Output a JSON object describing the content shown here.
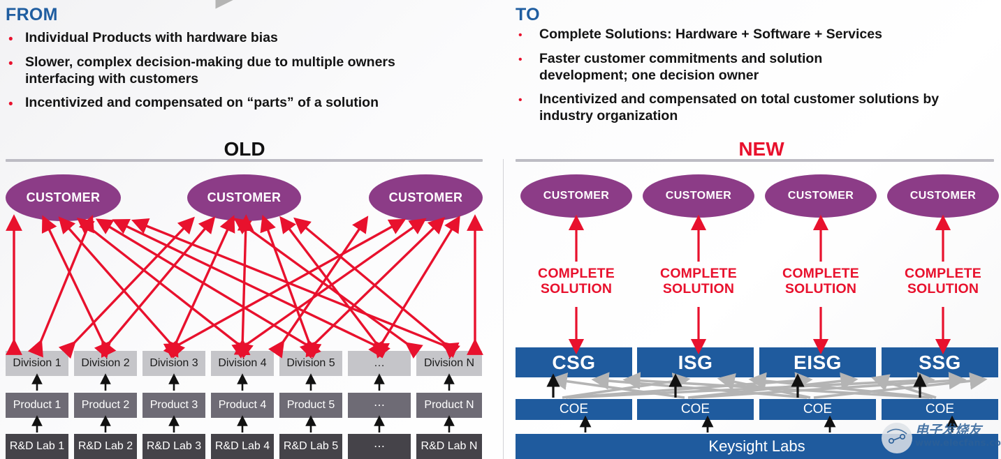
{
  "left": {
    "kicker": "FROM",
    "bullets": [
      "Individual Products with hardware bias",
      "Slower, complex decision-making due to multiple owners interfacing with customers",
      "Incentivized and compensated on “parts” of a solution"
    ],
    "section_title": "OLD",
    "customers": [
      "CUSTOMER",
      "CUSTOMER",
      "CUSTOMER"
    ],
    "divisions": [
      "Division 1",
      "Division 2",
      "Division 3",
      "Division 4",
      "Division 5",
      "…",
      "Division N"
    ],
    "products": [
      "Product 1",
      "Product 2",
      "Product 3",
      "Product 4",
      "Product 5",
      "⋯",
      "Product N"
    ],
    "rd_labs": [
      "R&D Lab 1",
      "R&D Lab 2",
      "R&D Lab 3",
      "R&D Lab 4",
      "R&D Lab 5",
      "⋯",
      "R&D Lab N"
    ]
  },
  "right": {
    "kicker": "TO",
    "bullets": [
      "Complete Solutions: Hardware + Software + Services",
      "Faster customer commitments and solution development; one decision owner",
      "Incentivized and compensated on total customer solutions by industry organization"
    ],
    "section_title": "NEW",
    "customers": [
      "CUSTOMER",
      "CUSTOMER",
      "CUSTOMER",
      "CUSTOMER"
    ],
    "solution_labels": [
      {
        "line1": "COMPLETE",
        "line2": "SOLUTION"
      },
      {
        "line1": "COMPLETE",
        "line2": "SOLUTION"
      },
      {
        "line1": "COMPLETE",
        "line2": "SOLUTION"
      },
      {
        "line1": "COMPLETE",
        "line2": "SOLUTION"
      }
    ],
    "groups": [
      "CSG",
      "ISG",
      "EISG",
      "SSG"
    ],
    "coes": [
      "COE",
      "COE",
      "COE",
      "COE"
    ],
    "labs_bar": "Keysight Labs"
  },
  "watermark": {
    "cn": "电子发烧友",
    "url": "www.elecfans.com"
  },
  "colors": {
    "kicker_blue": "#1F5DA0",
    "accent_red": "#E8112D",
    "purple": "#8C3C87",
    "blue_box": "#1F5B9E",
    "grey_light": "#C5C5C9",
    "grey_mid": "#6E6B75",
    "grey_dark": "#454349",
    "rule": "#BDBCC4"
  }
}
